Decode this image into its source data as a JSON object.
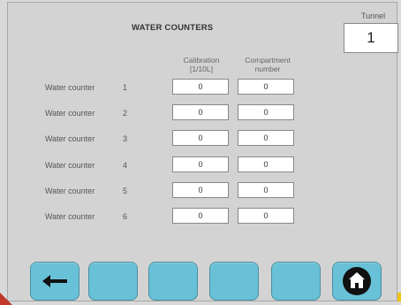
{
  "header": {
    "title": "WATER COUNTERS",
    "tunnel_label": "Tunnel",
    "tunnel_value": "1"
  },
  "columns": {
    "calibration": "Calibration\n[1/10L]",
    "compartment": "Compartment\nnumber"
  },
  "rows": [
    {
      "label": "Water counter",
      "num": "1",
      "calibration": "0",
      "compartment": "0"
    },
    {
      "label": "Water counter",
      "num": "2",
      "calibration": "0",
      "compartment": "0"
    },
    {
      "label": "Water counter",
      "num": "3",
      "calibration": "0",
      "compartment": "0"
    },
    {
      "label": "Water counter",
      "num": "4",
      "calibration": "0",
      "compartment": "0"
    },
    {
      "label": "Water counter",
      "num": "5",
      "calibration": "0",
      "compartment": "0"
    },
    {
      "label": "Water counter",
      "num": "6",
      "calibration": "0",
      "compartment": "0"
    }
  ],
  "toolbar": {
    "back_icon": "arrow-left-icon",
    "home_icon": "home-icon"
  },
  "colors": {
    "button": "#68c1d6",
    "background": "#d3d3d3"
  }
}
